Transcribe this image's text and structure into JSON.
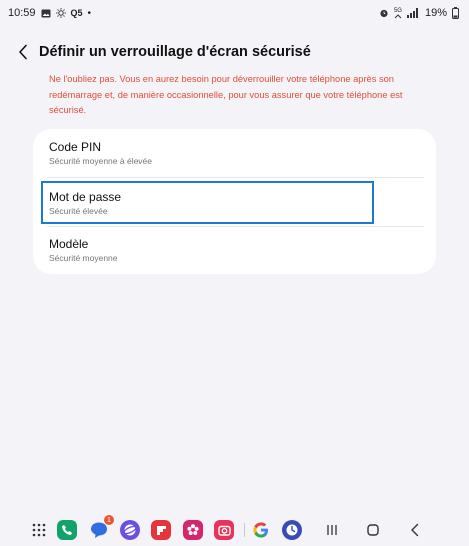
{
  "status_bar": {
    "time": "10:59",
    "extra_label": "Q5",
    "network": "5G",
    "battery": "19%"
  },
  "header": {
    "title": "Définir un verrouillage d'écran sécurisé",
    "back_icon": "chevron-left-icon"
  },
  "warning": {
    "text": "Ne l'oubliez pas. Vous en aurez besoin pour déverrouiller votre téléphone après son redémarrage et, de manière occasionnelle, pour vous assurer que votre téléphone est sécurisé.",
    "color": "#e04e3a"
  },
  "options": [
    {
      "title": "Code PIN",
      "subtitle": "Sécurité moyenne à élevée"
    },
    {
      "title": "Mot de passe",
      "subtitle": "Sécurité élevée",
      "focused": true
    },
    {
      "title": "Modèle",
      "subtitle": "Sécurité moyenne"
    }
  ],
  "taskbar": {
    "apps": [
      {
        "name": "apps-grid-icon"
      },
      {
        "name": "phone-app-icon",
        "color": "#12a36c"
      },
      {
        "name": "messages-app-icon",
        "color": "#2f6de0",
        "badge": "1"
      },
      {
        "name": "internet-app-icon",
        "color": "#6b4fe3"
      },
      {
        "name": "flipboard-app-icon",
        "color": "#e5343c"
      },
      {
        "name": "gallery-app-icon",
        "color": "#d6246e"
      },
      {
        "name": "camera-app-icon",
        "color": "#e8325a"
      },
      {
        "name": "google-app-icon"
      },
      {
        "name": "settings-pinned-app-icon",
        "color": "#3a4bb8"
      }
    ],
    "nav": [
      "recents-icon",
      "home-icon",
      "back-icon"
    ]
  },
  "colors": {
    "background": "#f4f3f8",
    "card": "#ffffff",
    "focus": "#1a7ad6"
  }
}
